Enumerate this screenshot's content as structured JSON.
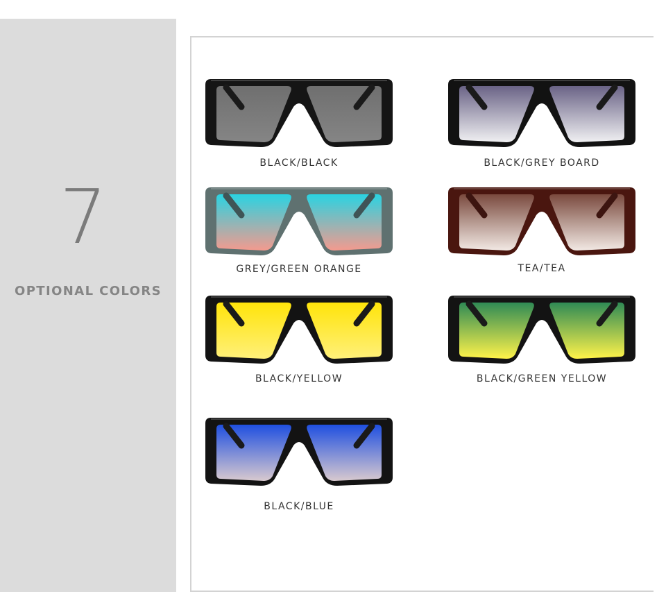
{
  "summary": {
    "count": "7",
    "label": "OPTIONAL COLORS"
  },
  "variants": [
    {
      "caption": "BLACK/BLACK",
      "frame_color": "#151515",
      "lens_top": "#6f6f6f",
      "lens_bottom": "#858585",
      "arm_color": "#1a1a1a"
    },
    {
      "caption": "BLACK/GREY BOARD",
      "frame_color": "#121212",
      "lens_top": "#6a6386",
      "lens_bottom": "#f0f0f2",
      "arm_color": "#1a1a1a"
    },
    {
      "caption": "GREY/GREEN ORANGE",
      "frame_color": "#5f7170",
      "lens_top": "#2ad3e2",
      "lens_bottom": "#f49a8e",
      "arm_color": "#3f5456"
    },
    {
      "caption": "TEA/TEA",
      "frame_color": "#4a160f",
      "lens_top": "#7a4a3e",
      "lens_bottom": "#f2e9e4",
      "arm_color": "#3d1510"
    },
    {
      "caption": "BLACK/YELLOW",
      "frame_color": "#131313",
      "lens_top": "#ffe40a",
      "lens_bottom": "#fff07a",
      "arm_color": "#1a1a1a"
    },
    {
      "caption": "BLACK/GREEN YELLOW",
      "frame_color": "#131313",
      "lens_top": "#2f8a55",
      "lens_bottom": "#fff34a",
      "arm_color": "#1a1a1a"
    },
    {
      "caption": "BLACK/BLUE",
      "frame_color": "#131313",
      "lens_top": "#1f4fe0",
      "lens_bottom": "#d8c9cf",
      "arm_color": "#1a1a1a"
    }
  ]
}
